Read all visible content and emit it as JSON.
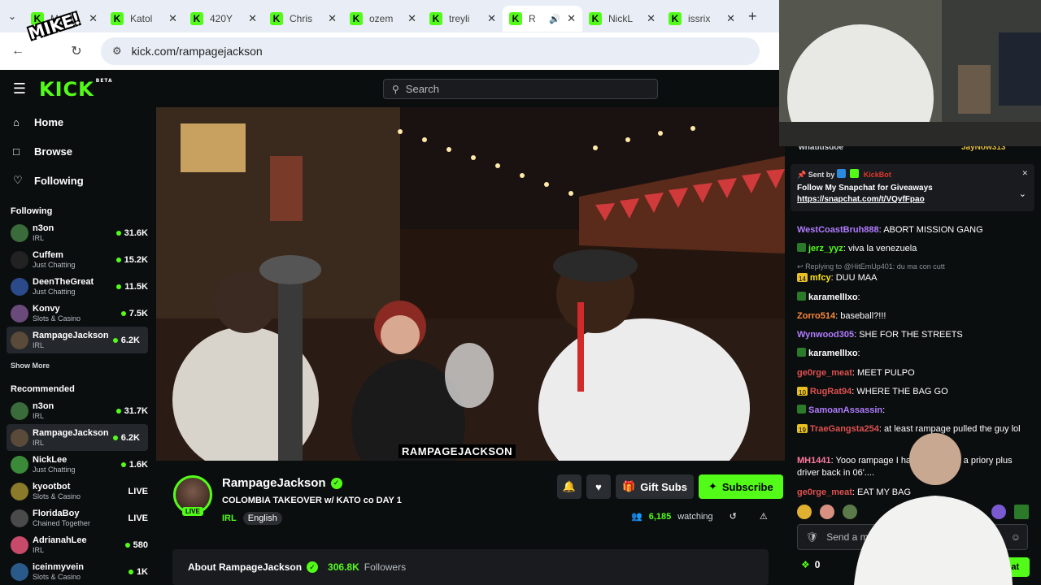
{
  "browser": {
    "tabs": [
      {
        "label": "M"
      },
      {
        "label": "Katol"
      },
      {
        "label": "420Y"
      },
      {
        "label": "Chris"
      },
      {
        "label": "ozem"
      },
      {
        "label": "treyli"
      },
      {
        "label": "R",
        "active": true
      },
      {
        "label": "NickL"
      },
      {
        "label": "issrix"
      }
    ],
    "url": "kick.com/rampagejackson",
    "sticker": "MIKE!"
  },
  "header": {
    "logo": "KICK",
    "logo_sup": "BETA",
    "search_placeholder": "Search"
  },
  "sidebar": {
    "nav": [
      {
        "label": "Home",
        "icon": "home-icon"
      },
      {
        "label": "Browse",
        "icon": "browse-icon"
      },
      {
        "label": "Following",
        "icon": "heart-icon"
      }
    ],
    "following_title": "Following",
    "following": [
      {
        "name": "n3on",
        "category": "IRL",
        "count": "31.6K",
        "color": "#3a6b3a"
      },
      {
        "name": "Cuffem",
        "category": "Just Chatting",
        "count": "15.2K",
        "color": "#222222"
      },
      {
        "name": "DeenTheGreat",
        "category": "Just Chatting",
        "count": "11.5K",
        "color": "#2a4a8a"
      },
      {
        "name": "Konvy",
        "category": "Slots & Casino",
        "count": "7.5K",
        "color": "#6a4a7a"
      },
      {
        "name": "RampageJackson",
        "category": "IRL",
        "count": "6.2K",
        "color": "#5a4a3a"
      }
    ],
    "show_more": "Show More",
    "recommended_title": "Recommended",
    "recommended": [
      {
        "name": "n3on",
        "category": "IRL",
        "count": "31.7K",
        "color": "#3a6b3a"
      },
      {
        "name": "RampageJackson",
        "category": "IRL",
        "count": "6.2K",
        "color": "#5a4a3a"
      },
      {
        "name": "NickLee",
        "category": "Just Chatting",
        "count": "1.6K",
        "color": "#3a8a3a"
      },
      {
        "name": "kyootbot",
        "category": "Slots & Casino",
        "count": "LIVE",
        "color": "#8a7a2a"
      },
      {
        "name": "FloridaBoy",
        "category": "Chained Together",
        "count": "LIVE",
        "color": "#4a4a4a"
      },
      {
        "name": "AdrianahLee",
        "category": "IRL",
        "count": "580",
        "color": "#c84a6a"
      },
      {
        "name": "iceinmyvein",
        "category": "Slots & Casino",
        "count": "1K",
        "color": "#2a5a8a"
      }
    ]
  },
  "video": {
    "caption": "RAMPAGEJACKSON"
  },
  "channel": {
    "name": "RampageJackson",
    "live": "LIVE",
    "title": "COLOMBIA TAKEOVER w/ KATO co  DAY 1",
    "category": "IRL",
    "language": "English",
    "gift_subs": "Gift Subs",
    "subscribe": "Subscribe",
    "watching_count": "6,185",
    "watching_label": "watching",
    "about_label": "About RampageJackson",
    "followers_count": "306.8K",
    "followers_label": "Followers"
  },
  "chat": {
    "top_users": [
      "whatitisdoe",
      "JayNow313"
    ],
    "pinned": {
      "sent_by": "Sent by",
      "sender": "KickBot",
      "message": "Follow My Snapchat for Giveaways",
      "link": "https://snapchat.com/t/VQvfFpao"
    },
    "messages": [
      {
        "user": "WestCoastBruh888",
        "color": "#b07cff",
        "text": "ABORT MISSION GANG"
      },
      {
        "user": "jerz_yyz",
        "color": "#53fc18",
        "text": "viva la venezuela"
      },
      {
        "reply": "Replying to @HitEmUp401: du ma con cutt"
      },
      {
        "user": "mfcy",
        "color": "#ffe600",
        "text": "DUU MAA"
      },
      {
        "user": "karamellIxo",
        "color": "#fff",
        "text": ""
      },
      {
        "user": "Zorro514",
        "color": "#ff8a3a",
        "text": "baseball?!!!"
      },
      {
        "user": "Wynwood305",
        "color": "#b07cff",
        "text": "SHE FOR THE STREETS"
      },
      {
        "user": "karamellIxo",
        "color": "#fff",
        "text": ""
      },
      {
        "user": "ge0rge_meat",
        "color": "#e05050",
        "text": "MEET PULPO"
      },
      {
        "user": "RugRat94",
        "color": "#e05050",
        "text": "WHERE THE BAG GO"
      },
      {
        "user": "SamoanAssassin",
        "color": "#b07cff",
        "text": ""
      },
      {
        "user": "TraeGangsta254",
        "color": "#e05050",
        "text": "at least rampage pulled the guy lol"
      },
      {
        "user": "MH1441",
        "color": "#ff7aa0",
        "text": "Yooo rampage I hav... you were a priory plus driver back in 06'...."
      },
      {
        "user": "ge0rge_meat",
        "color": "#e05050",
        "text": "EAT MY BAG"
      }
    ],
    "badge_nums": [
      "14",
      "10",
      "19"
    ],
    "input_placeholder": "Send a message",
    "points": "0",
    "send_label": "Chat"
  }
}
